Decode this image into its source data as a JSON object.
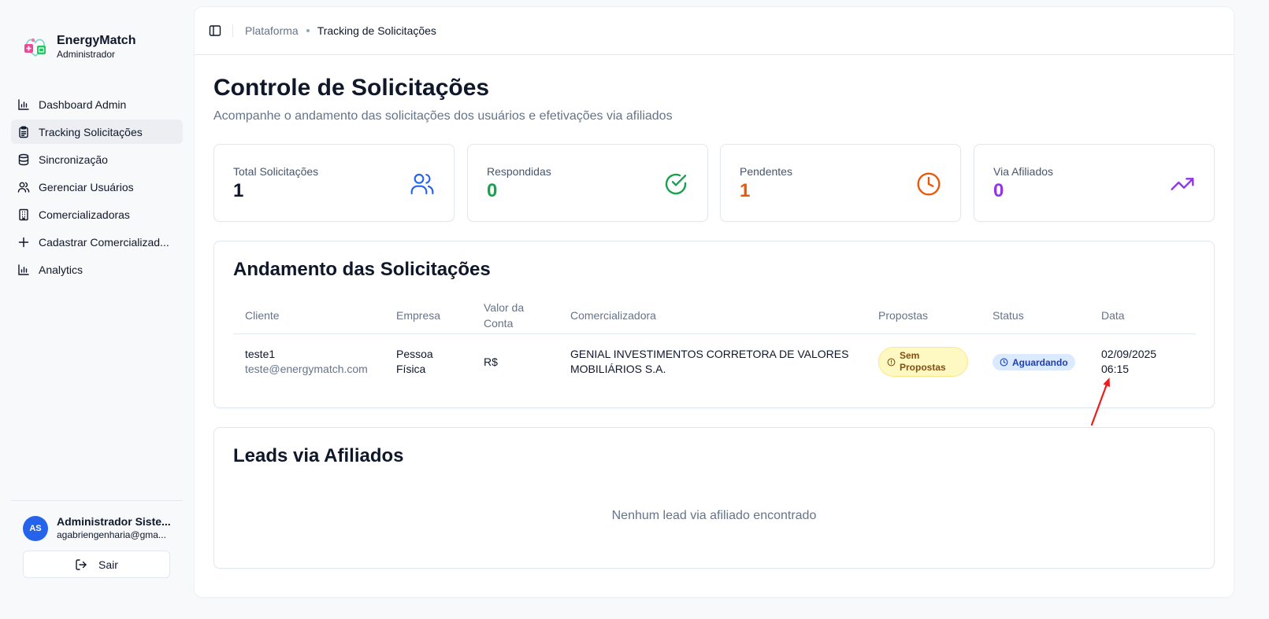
{
  "app": {
    "name": "EnergyMatch",
    "role": "Administrador"
  },
  "nav": [
    {
      "label": "Dashboard Admin",
      "icon": "bar-chart-icon",
      "active": false
    },
    {
      "label": "Tracking Solicitações",
      "icon": "clipboard-icon",
      "active": true
    },
    {
      "label": "Sincronização",
      "icon": "database-icon",
      "active": false
    },
    {
      "label": "Gerenciar Usuários",
      "icon": "users-icon",
      "active": false
    },
    {
      "label": "Comercializadoras",
      "icon": "building-icon",
      "active": false
    },
    {
      "label": "Cadastrar Comercializad...",
      "icon": "plus-icon",
      "active": false
    },
    {
      "label": "Analytics",
      "icon": "bar-chart-icon",
      "active": false
    }
  ],
  "user": {
    "initials": "AS",
    "name": "Administrador Siste...",
    "email": "agabriengenharia@gma...",
    "logout_label": "Sair"
  },
  "breadcrumb": {
    "root": "Plataforma",
    "current": "Tracking de Solicitações"
  },
  "page": {
    "title": "Controle de Solicitações",
    "subtitle": "Acompanhe o andamento das solicitações dos usuários e efetivações via afiliados"
  },
  "stats": [
    {
      "label": "Total Solicitações",
      "value": "1",
      "color": "#0f172a",
      "icon": "users-icon",
      "icon_color": "#2563eb"
    },
    {
      "label": "Respondidas",
      "value": "0",
      "color": "#16a34a",
      "icon": "check-circle-icon",
      "icon_color": "#16a34a"
    },
    {
      "label": "Pendentes",
      "value": "1",
      "color": "#ea580c",
      "icon": "clock-icon",
      "icon_color": "#ea580c"
    },
    {
      "label": "Via Afiliados",
      "value": "0",
      "color": "#9333ea",
      "icon": "trending-up-icon",
      "icon_color": "#9333ea"
    }
  ],
  "requests": {
    "title": "Andamento das Solicitações",
    "columns": {
      "cliente": "Cliente",
      "empresa": "Empresa",
      "valor_1": "Valor da",
      "valor_2": "Conta",
      "comercializadora": "Comercializadora",
      "propostas": "Propostas",
      "status": "Status",
      "data": "Data"
    },
    "rows": [
      {
        "cliente_nome": "teste1",
        "cliente_email": "teste@energymatch.com",
        "empresa_1": "Pessoa",
        "empresa_2": "Física",
        "valor": "R$",
        "comercializadora_1": "GENIAL INVESTIMENTOS CORRETORA DE VALORES",
        "comercializadora_2": "MOBILIÁRIOS S.A.",
        "propostas_1": "Sem",
        "propostas_2": "Propostas",
        "status": "Aguardando",
        "data_1": "02/09/2025",
        "data_2": "06:15"
      }
    ]
  },
  "leads": {
    "title": "Leads via Afiliados",
    "empty_message": "Nenhum lead via afiliado encontrado"
  },
  "colors": {
    "accent": "#2563eb",
    "annotation_arrow": "#ef1c1c"
  }
}
